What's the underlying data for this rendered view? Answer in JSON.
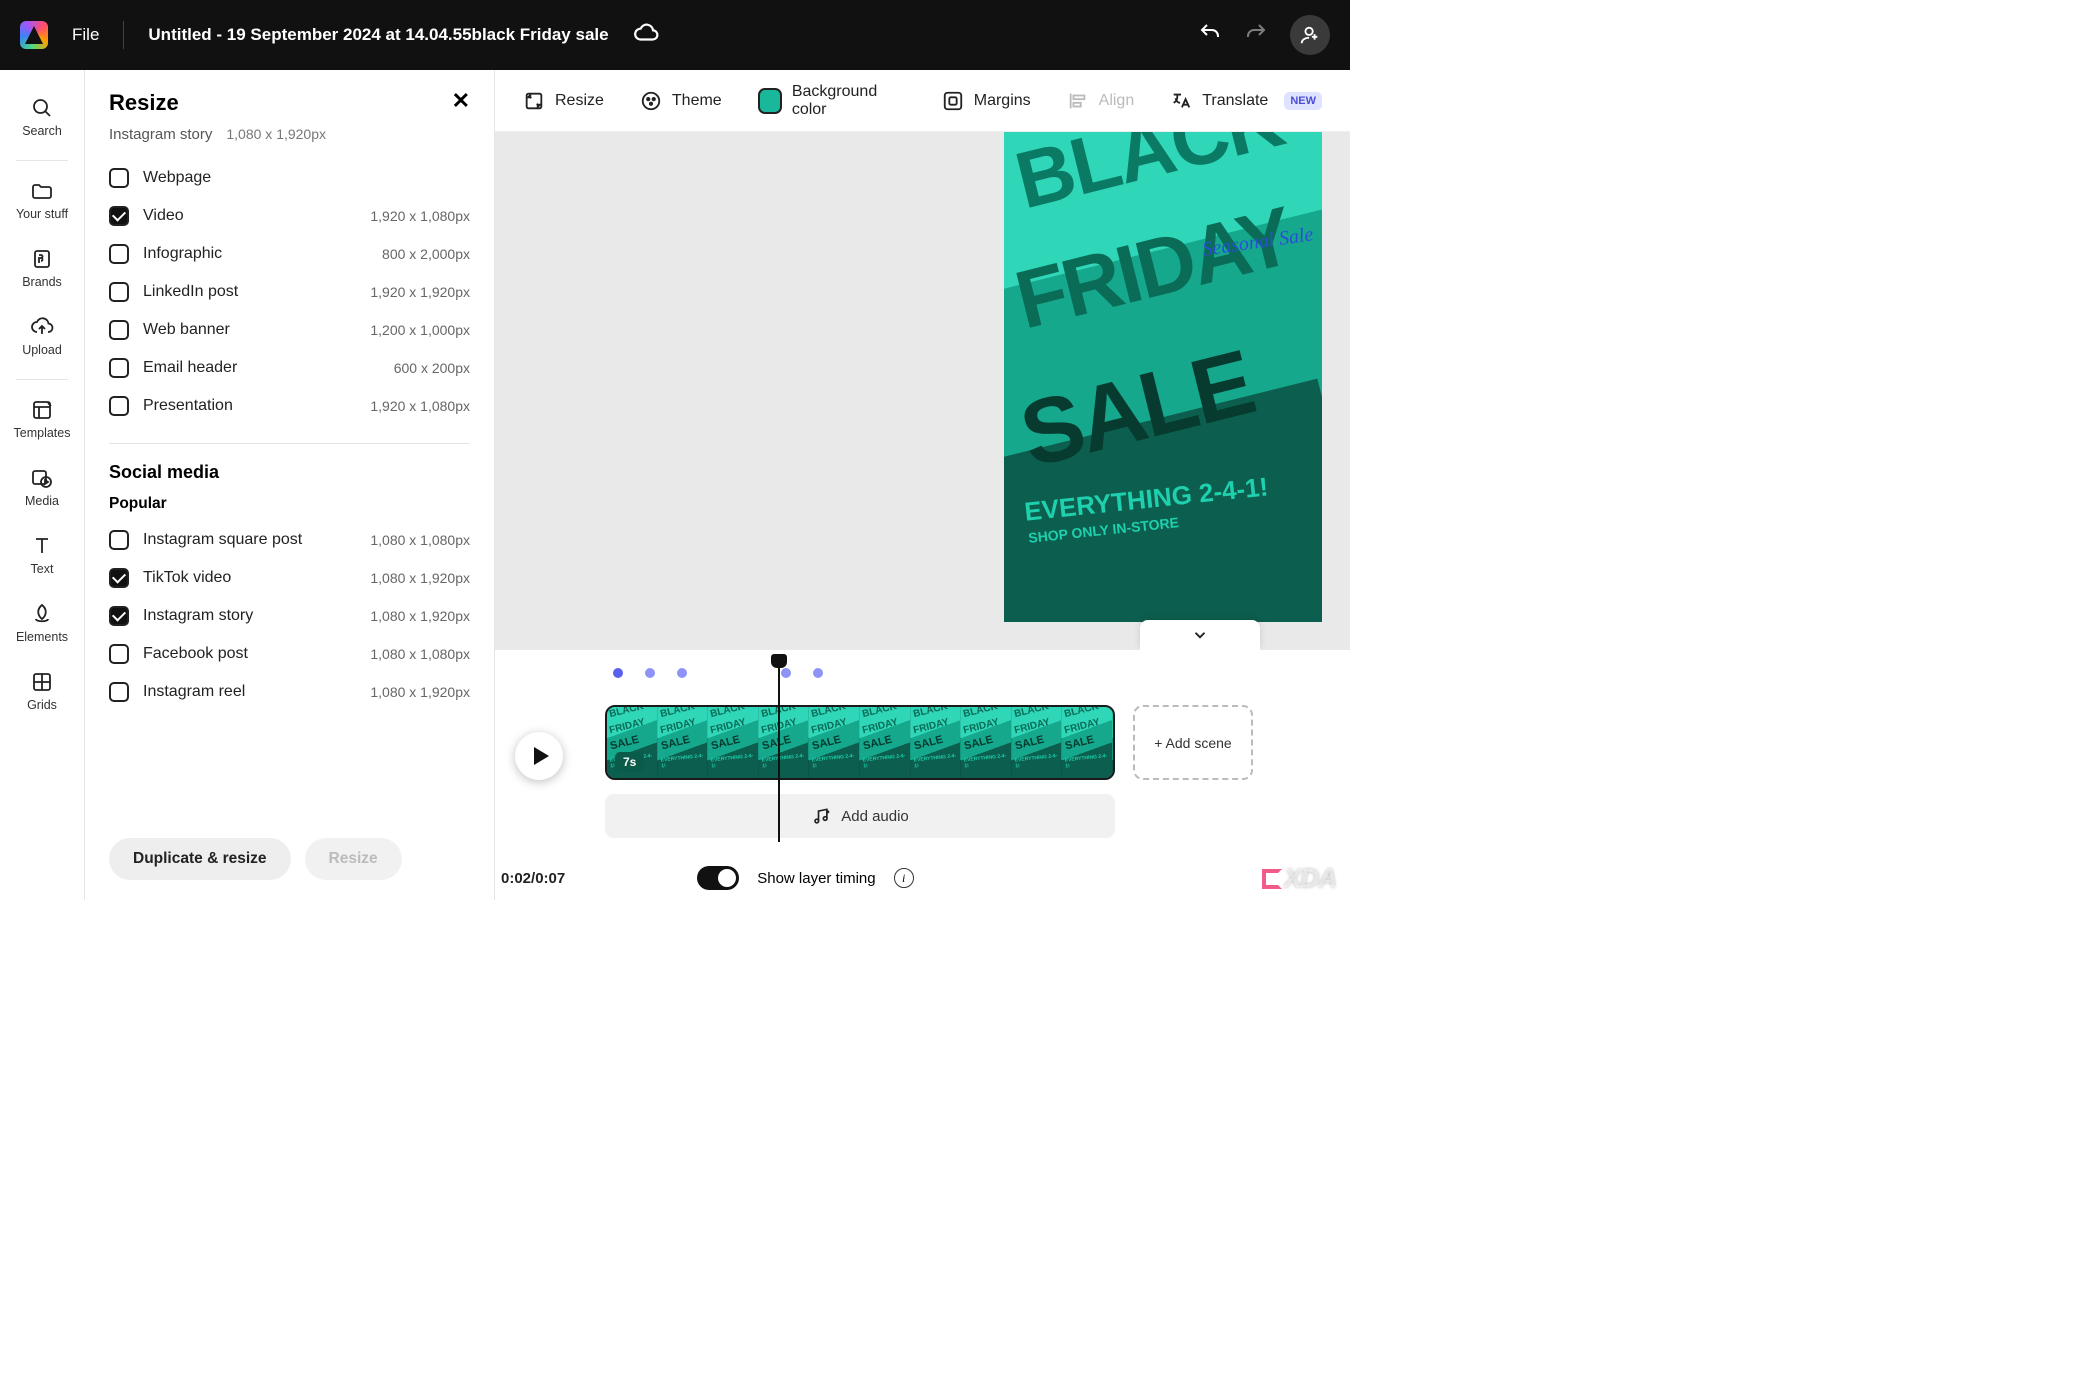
{
  "topbar": {
    "file_label": "File",
    "doc_title": "Untitled - 19 September 2024 at 14.04.55black Friday sale"
  },
  "rail": {
    "search": "Search",
    "your_stuff": "Your stuff",
    "brands": "Brands",
    "upload": "Upload",
    "templates": "Templates",
    "media": "Media",
    "text": "Text",
    "elements": "Elements",
    "grids": "Grids"
  },
  "panel": {
    "title": "Resize",
    "current_preset": "Instagram story",
    "current_dim": "1,080 x 1,920px",
    "sizes": [
      {
        "label": "Webpage",
        "dim": "",
        "checked": false
      },
      {
        "label": "Video",
        "dim": "1,920 x 1,080px",
        "checked": true
      },
      {
        "label": "Infographic",
        "dim": "800 x 2,000px",
        "checked": false
      },
      {
        "label": "LinkedIn post",
        "dim": "1,920 x 1,920px",
        "checked": false
      },
      {
        "label": "Web banner",
        "dim": "1,200 x 1,000px",
        "checked": false
      },
      {
        "label": "Email header",
        "dim": "600 x 200px",
        "checked": false
      },
      {
        "label": "Presentation",
        "dim": "1,920 x 1,080px",
        "checked": false
      }
    ],
    "social_heading": "Social media",
    "popular_heading": "Popular",
    "social": [
      {
        "label": "Instagram square post",
        "dim": "1,080 x 1,080px",
        "checked": false
      },
      {
        "label": "TikTok video",
        "dim": "1,080 x 1,920px",
        "checked": true
      },
      {
        "label": "Instagram story",
        "dim": "1,080 x 1,920px",
        "checked": true
      },
      {
        "label": "Facebook post",
        "dim": "1,080 x 1,080px",
        "checked": false
      },
      {
        "label": "Instagram reel",
        "dim": "1,080 x 1,920px",
        "checked": false
      }
    ],
    "duplicate_btn": "Duplicate & resize",
    "resize_btn": "Resize"
  },
  "actionbar": {
    "resize": "Resize",
    "theme": "Theme",
    "bgcolor": "Background color",
    "bgcolor_value": "#19b89b",
    "margins": "Margins",
    "align": "Align",
    "translate": "Translate",
    "new_badge": "NEW"
  },
  "artwork": {
    "black": "BLACK",
    "friday": "FRIDAY",
    "sale": "SALE",
    "everything": "EVERYTHING 2-4-1!",
    "shop": "SHOP ONLY IN-STORE",
    "seasonal": "Seasonal\nSale"
  },
  "timeline": {
    "clip_duration": "7s",
    "add_scene": "+ Add scene",
    "add_audio": "Add audio",
    "time": "0:02/0:07",
    "layer_timing": "Show layer timing"
  },
  "watermark": "XDA"
}
